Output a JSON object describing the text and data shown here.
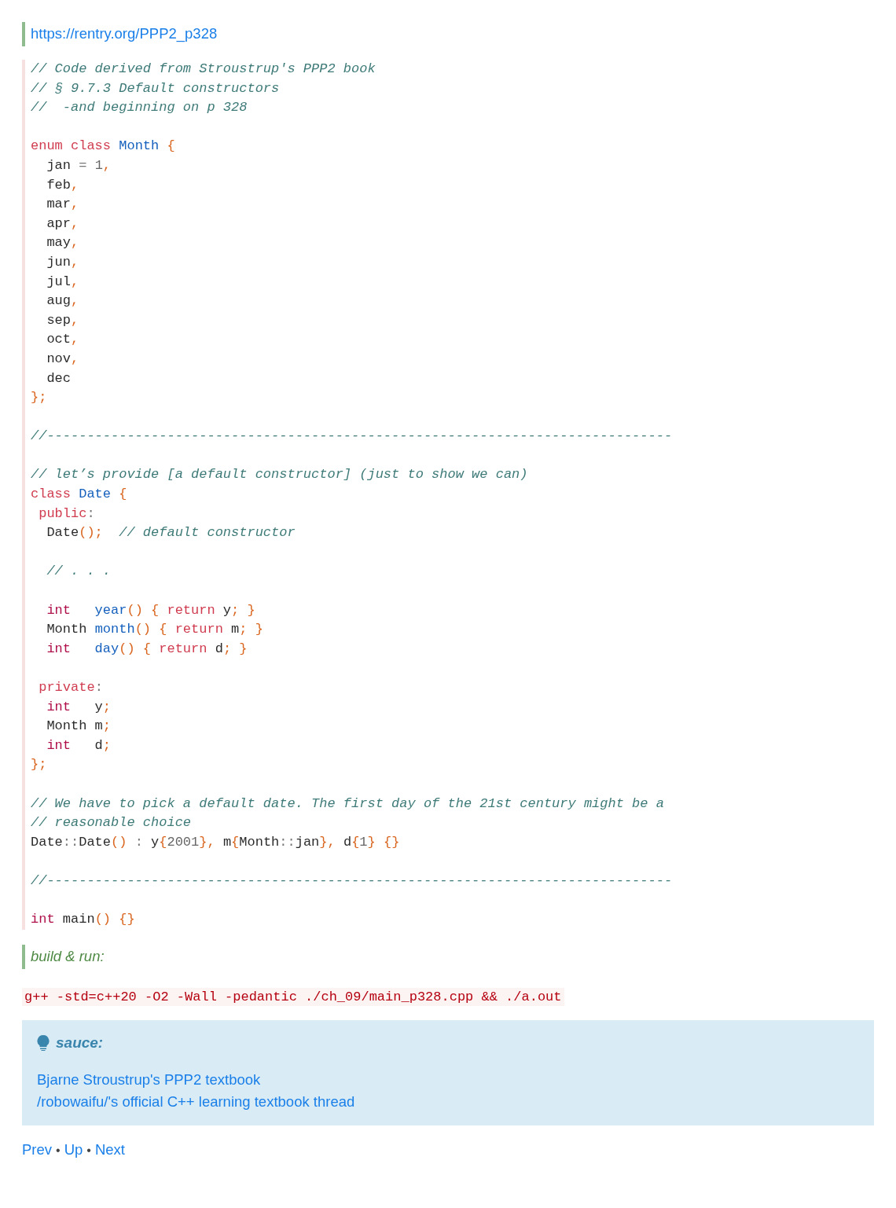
{
  "source_link": {
    "text": "https://rentry.org/PPP2_p328"
  },
  "code": {
    "lines": [
      {
        "kind": "code",
        "tokens": [
          {
            "kind": "comment",
            "text": "// Code derived from Stroustrup's PPP2 book"
          }
        ]
      },
      {
        "kind": "code",
        "tokens": [
          {
            "kind": "comment",
            "text": "// § 9.7.3 Default constructors"
          }
        ]
      },
      {
        "kind": "code",
        "tokens": [
          {
            "kind": "comment",
            "text": "//  -and beginning on p 328"
          }
        ]
      },
      {
        "kind": "blank"
      },
      {
        "kind": "code",
        "tokens": [
          {
            "kind": "keyword",
            "text": "enum class"
          },
          {
            "kind": "name",
            "text": " Month"
          },
          {
            "kind": "punct",
            "text": " {"
          }
        ]
      },
      {
        "kind": "code",
        "tokens": [
          {
            "kind": "plain",
            "text": "  jan "
          },
          {
            "kind": "operator",
            "text": "= "
          },
          {
            "kind": "number",
            "text": "1"
          },
          {
            "kind": "punct",
            "text": ","
          }
        ]
      },
      {
        "kind": "code",
        "tokens": [
          {
            "kind": "plain",
            "text": "  feb"
          },
          {
            "kind": "punct",
            "text": ","
          }
        ]
      },
      {
        "kind": "code",
        "tokens": [
          {
            "kind": "plain",
            "text": "  mar"
          },
          {
            "kind": "punct",
            "text": ","
          }
        ]
      },
      {
        "kind": "code",
        "tokens": [
          {
            "kind": "plain",
            "text": "  apr"
          },
          {
            "kind": "punct",
            "text": ","
          }
        ]
      },
      {
        "kind": "code",
        "tokens": [
          {
            "kind": "plain",
            "text": "  may"
          },
          {
            "kind": "punct",
            "text": ","
          }
        ]
      },
      {
        "kind": "code",
        "tokens": [
          {
            "kind": "plain",
            "text": "  jun"
          },
          {
            "kind": "punct",
            "text": ","
          }
        ]
      },
      {
        "kind": "code",
        "tokens": [
          {
            "kind": "plain",
            "text": "  jul"
          },
          {
            "kind": "punct",
            "text": ","
          }
        ]
      },
      {
        "kind": "code",
        "tokens": [
          {
            "kind": "plain",
            "text": "  aug"
          },
          {
            "kind": "punct",
            "text": ","
          }
        ]
      },
      {
        "kind": "code",
        "tokens": [
          {
            "kind": "plain",
            "text": "  sep"
          },
          {
            "kind": "punct",
            "text": ","
          }
        ]
      },
      {
        "kind": "code",
        "tokens": [
          {
            "kind": "plain",
            "text": "  oct"
          },
          {
            "kind": "punct",
            "text": ","
          }
        ]
      },
      {
        "kind": "code",
        "tokens": [
          {
            "kind": "plain",
            "text": "  nov"
          },
          {
            "kind": "punct",
            "text": ","
          }
        ]
      },
      {
        "kind": "code",
        "tokens": [
          {
            "kind": "plain",
            "text": "  dec"
          }
        ]
      },
      {
        "kind": "code",
        "tokens": [
          {
            "kind": "punct",
            "text": "};"
          }
        ]
      },
      {
        "kind": "blank"
      },
      {
        "kind": "code",
        "tokens": [
          {
            "kind": "comment",
            "text": "//------------------------------------------------------------------------------"
          }
        ]
      },
      {
        "kind": "blank"
      },
      {
        "kind": "code",
        "tokens": [
          {
            "kind": "comment",
            "text": "// let’s provide [a default constructor] (just to show we can)"
          }
        ]
      },
      {
        "kind": "code",
        "tokens": [
          {
            "kind": "keyword",
            "text": "class"
          },
          {
            "kind": "name",
            "text": " Date"
          },
          {
            "kind": "punct",
            "text": " {"
          }
        ]
      },
      {
        "kind": "code",
        "tokens": [
          {
            "kind": "keyword",
            "text": " public"
          },
          {
            "kind": "operator",
            "text": ":"
          }
        ]
      },
      {
        "kind": "code",
        "tokens": [
          {
            "kind": "plain",
            "text": "  Date"
          },
          {
            "kind": "punct",
            "text": "();"
          },
          {
            "kind": "comment",
            "text": "  // default constructor"
          }
        ]
      },
      {
        "kind": "blank"
      },
      {
        "kind": "code",
        "tokens": [
          {
            "kind": "comment",
            "text": "  // . . ."
          }
        ]
      },
      {
        "kind": "blank"
      },
      {
        "kind": "code",
        "tokens": [
          {
            "kind": "type",
            "text": "  int"
          },
          {
            "kind": "name",
            "text": "   year"
          },
          {
            "kind": "punct",
            "text": "() { "
          },
          {
            "kind": "keyword",
            "text": "return"
          },
          {
            "kind": "plain",
            "text": " y"
          },
          {
            "kind": "punct",
            "text": "; }"
          }
        ]
      },
      {
        "kind": "code",
        "tokens": [
          {
            "kind": "plain",
            "text": "  Month "
          },
          {
            "kind": "name",
            "text": "month"
          },
          {
            "kind": "punct",
            "text": "() { "
          },
          {
            "kind": "keyword",
            "text": "return"
          },
          {
            "kind": "plain",
            "text": " m"
          },
          {
            "kind": "punct",
            "text": "; }"
          }
        ]
      },
      {
        "kind": "code",
        "tokens": [
          {
            "kind": "type",
            "text": "  int"
          },
          {
            "kind": "name",
            "text": "   day"
          },
          {
            "kind": "punct",
            "text": "() { "
          },
          {
            "kind": "keyword",
            "text": "return"
          },
          {
            "kind": "plain",
            "text": " d"
          },
          {
            "kind": "punct",
            "text": "; }"
          }
        ]
      },
      {
        "kind": "blank"
      },
      {
        "kind": "code",
        "tokens": [
          {
            "kind": "keyword",
            "text": " private"
          },
          {
            "kind": "operator",
            "text": ":"
          }
        ]
      },
      {
        "kind": "code",
        "tokens": [
          {
            "kind": "type",
            "text": "  int"
          },
          {
            "kind": "plain",
            "text": "   y"
          },
          {
            "kind": "punct",
            "text": ";"
          }
        ]
      },
      {
        "kind": "code",
        "tokens": [
          {
            "kind": "plain",
            "text": "  Month m"
          },
          {
            "kind": "punct",
            "text": ";"
          }
        ]
      },
      {
        "kind": "code",
        "tokens": [
          {
            "kind": "type",
            "text": "  int"
          },
          {
            "kind": "plain",
            "text": "   d"
          },
          {
            "kind": "punct",
            "text": ";"
          }
        ]
      },
      {
        "kind": "code",
        "tokens": [
          {
            "kind": "punct",
            "text": "};"
          }
        ]
      },
      {
        "kind": "blank"
      },
      {
        "kind": "code",
        "tokens": [
          {
            "kind": "comment",
            "text": "// We have to pick a default date. The first day of the 21st century might be a"
          }
        ]
      },
      {
        "kind": "code",
        "tokens": [
          {
            "kind": "comment",
            "text": "// reasonable choice"
          }
        ]
      },
      {
        "kind": "code",
        "tokens": [
          {
            "kind": "plain",
            "text": "Date"
          },
          {
            "kind": "operator",
            "text": "::"
          },
          {
            "kind": "plain",
            "text": "Date"
          },
          {
            "kind": "punct",
            "text": "()"
          },
          {
            "kind": "operator",
            "text": " : "
          },
          {
            "kind": "plain",
            "text": "y"
          },
          {
            "kind": "punct",
            "text": "{"
          },
          {
            "kind": "number",
            "text": "2001"
          },
          {
            "kind": "punct",
            "text": "}, "
          },
          {
            "kind": "plain",
            "text": "m"
          },
          {
            "kind": "punct",
            "text": "{"
          },
          {
            "kind": "plain",
            "text": "Month"
          },
          {
            "kind": "operator",
            "text": "::"
          },
          {
            "kind": "plain",
            "text": "jan"
          },
          {
            "kind": "punct",
            "text": "}, "
          },
          {
            "kind": "plain",
            "text": "d"
          },
          {
            "kind": "punct",
            "text": "{"
          },
          {
            "kind": "number",
            "text": "1"
          },
          {
            "kind": "punct",
            "text": "} {}"
          }
        ]
      },
      {
        "kind": "blank"
      },
      {
        "kind": "code",
        "tokens": [
          {
            "kind": "comment",
            "text": "//------------------------------------------------------------------------------"
          }
        ]
      },
      {
        "kind": "blank"
      },
      {
        "kind": "code",
        "tokens": [
          {
            "kind": "type",
            "text": "int"
          },
          {
            "kind": "plain",
            "text": " main"
          },
          {
            "kind": "punct",
            "text": "() {}"
          }
        ]
      }
    ]
  },
  "build_note": {
    "text": "build & run:"
  },
  "command": {
    "text": "g++ -std=c++20 -O2 -Wall -pedantic ./ch_09/main_p328.cpp && ./a.out"
  },
  "admonition": {
    "title": "sauce:",
    "links": [
      {
        "text": "Bjarne Stroustrup's PPP2 textbook"
      },
      {
        "text": "/robowaifu/'s official C++ learning textbook thread"
      }
    ]
  },
  "nav": [
    {
      "kind": "link",
      "text": "Prev"
    },
    {
      "kind": "separator",
      "text": "•"
    },
    {
      "kind": "link",
      "text": "Up"
    },
    {
      "kind": "separator",
      "text": "•"
    },
    {
      "kind": "link",
      "text": "Next"
    }
  ]
}
